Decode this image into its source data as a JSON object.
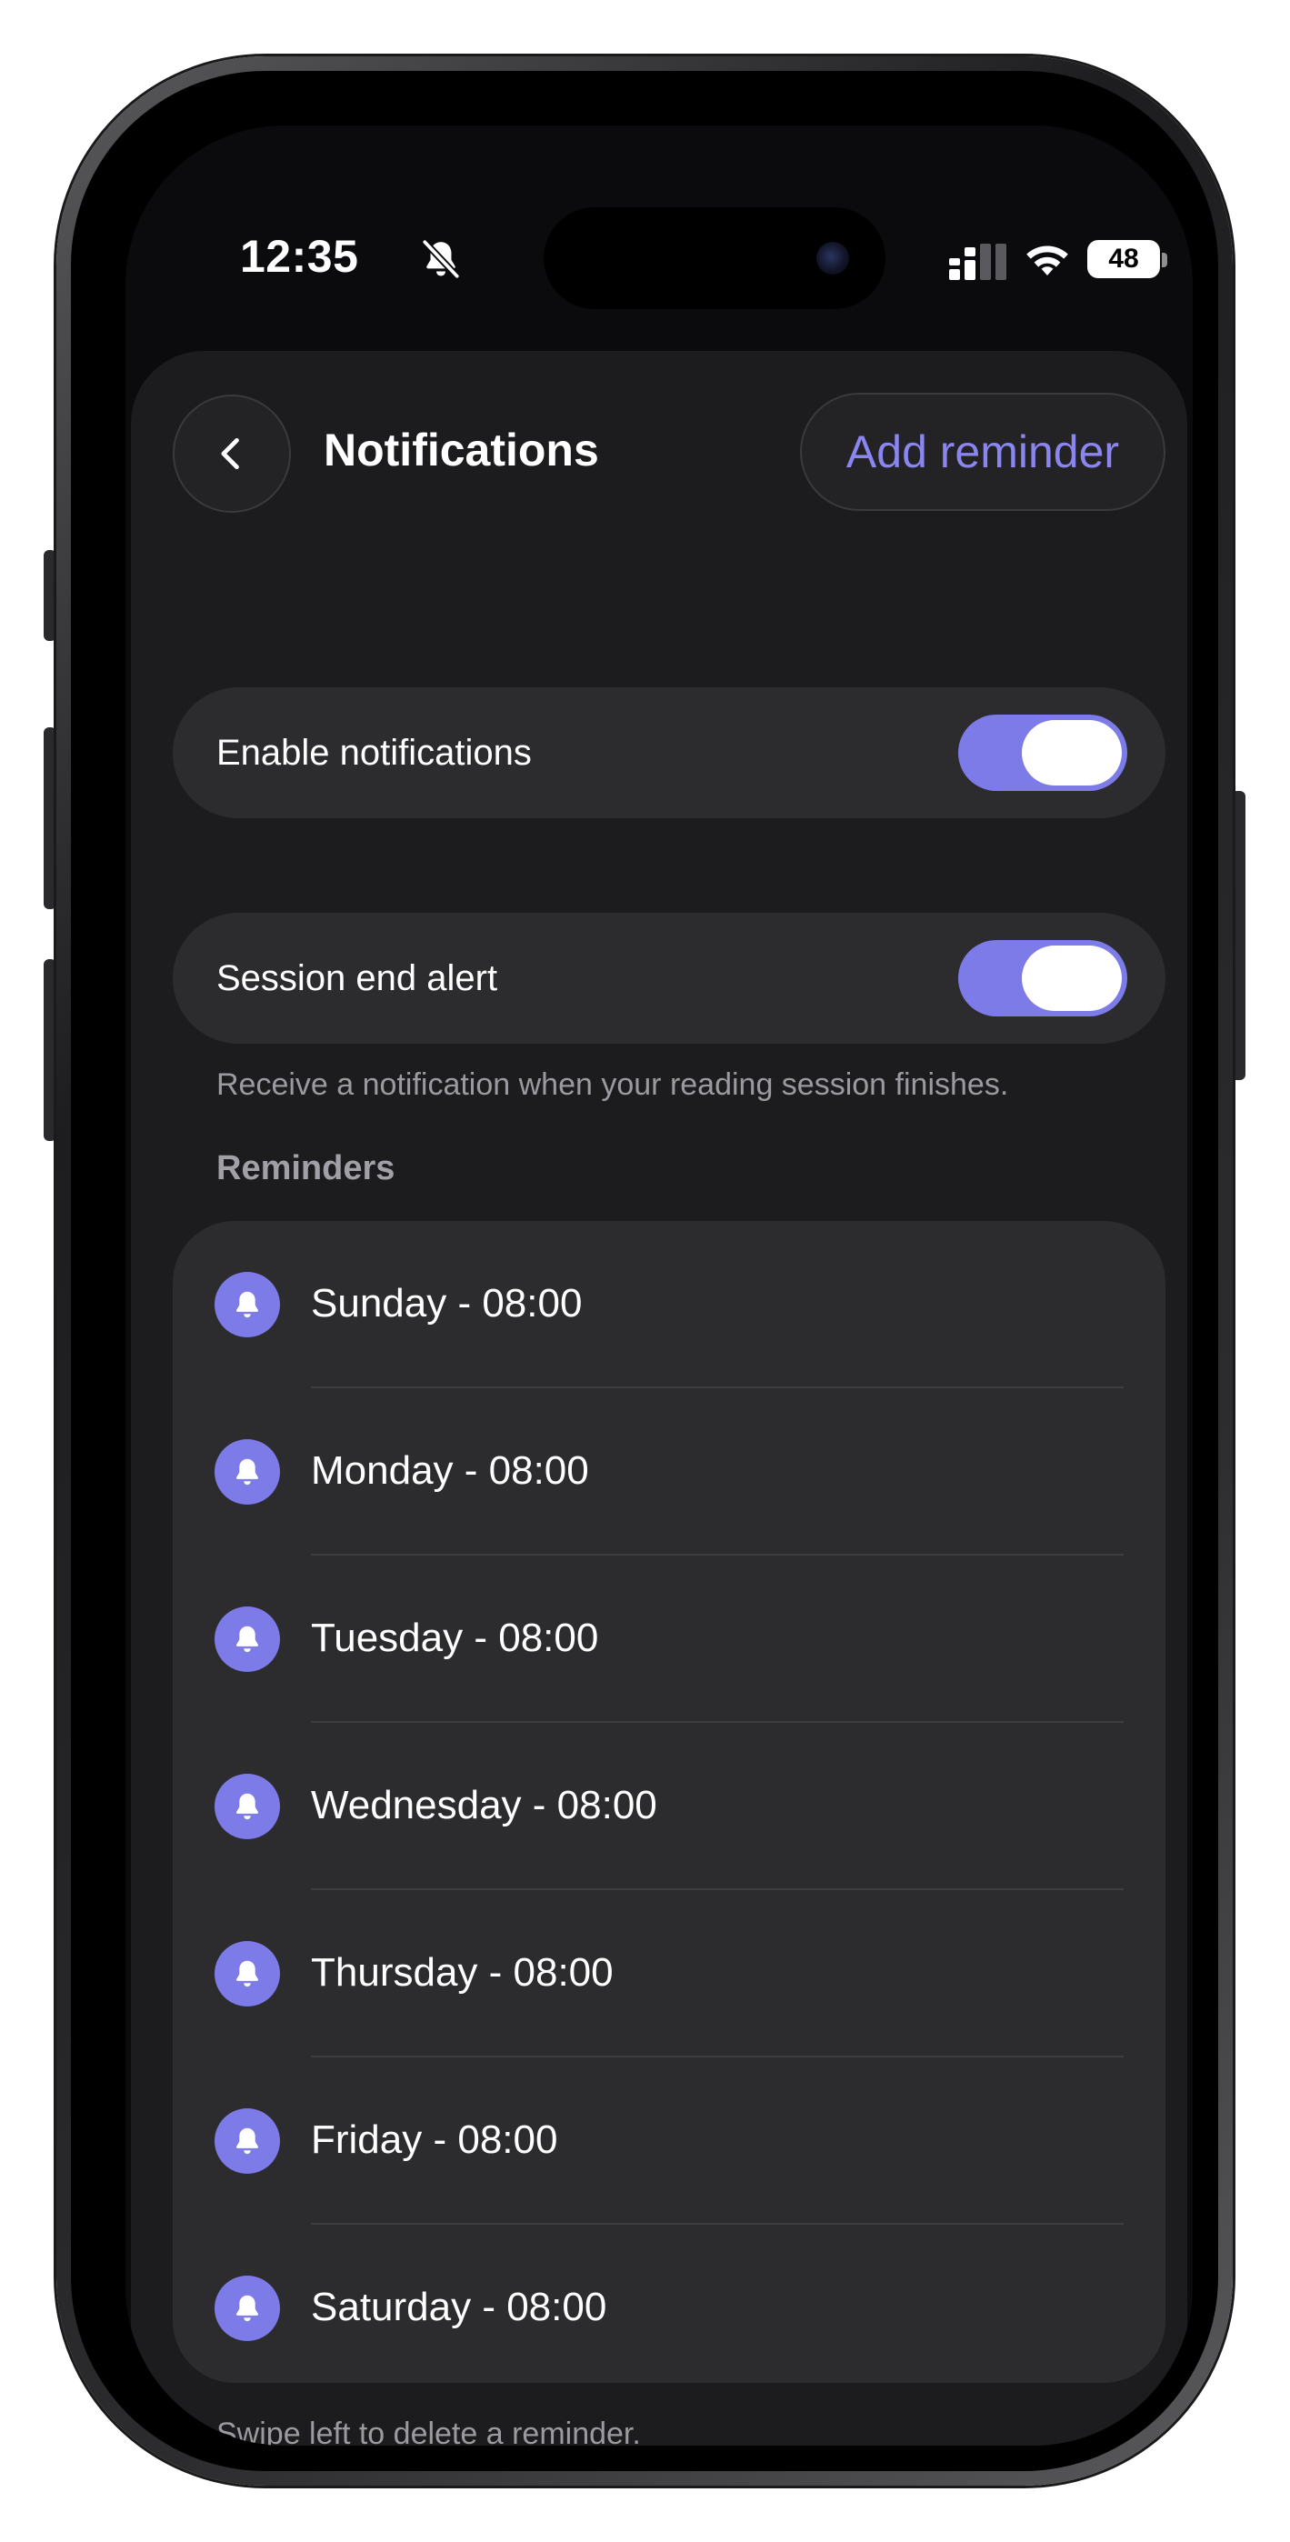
{
  "status_bar": {
    "time": "12:35",
    "battery": "48",
    "icons": [
      "bell-slash-icon",
      "cellular-signal-icon",
      "wifi-icon",
      "battery-icon"
    ]
  },
  "header": {
    "title": "Notifications",
    "back_icon": "chevron-left-icon",
    "add_label": "Add reminder"
  },
  "settings": {
    "enable_notifications": {
      "label": "Enable notifications",
      "on": true
    },
    "session_end_alert": {
      "label": "Session end alert",
      "on": true,
      "caption": "Receive a notification when your reading session finishes."
    }
  },
  "reminders": {
    "section_label": "Reminders",
    "icon": "bell-icon",
    "items": [
      {
        "label": "Sunday - 08:00"
      },
      {
        "label": "Monday - 08:00"
      },
      {
        "label": "Tuesday - 08:00"
      },
      {
        "label": "Wednesday - 08:00"
      },
      {
        "label": "Thursday - 08:00"
      },
      {
        "label": "Friday - 08:00"
      },
      {
        "label": "Saturday - 08:00"
      }
    ],
    "footer": "Swipe left to delete a reminder."
  },
  "colors": {
    "accent": "#7d7be8",
    "accent_text": "#8b85f0",
    "background": "#1c1c1e",
    "card": "#2c2c2e"
  }
}
